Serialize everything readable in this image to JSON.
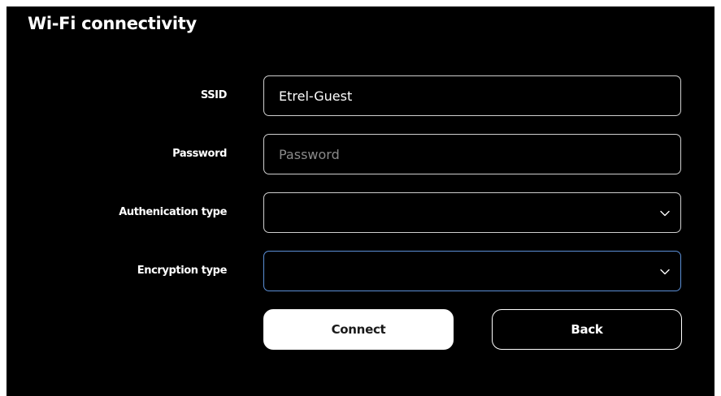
{
  "panel": {
    "title": "Wi-Fi connectivity"
  },
  "form": {
    "ssid": {
      "label": "SSID",
      "value": "Etrel-Guest",
      "placeholder": ""
    },
    "password": {
      "label": "Password",
      "value": "",
      "placeholder": "Password"
    },
    "authentication_type": {
      "label": "Authenication type",
      "selected": "",
      "icon": "chevron-down-icon"
    },
    "encryption_type": {
      "label": "Encryption type",
      "selected": "",
      "icon": "chevron-down-icon"
    }
  },
  "buttons": {
    "connect_label": "Connect",
    "back_label": "Back"
  },
  "colors": {
    "panel_background": "#000000",
    "text": "#ffffff",
    "field_border": "#cfcfcf",
    "focus_border": "#5b8fd6",
    "placeholder": "#8a8a8a",
    "primary_button_bg": "#ffffff",
    "primary_button_text": "#1a1a1a"
  }
}
